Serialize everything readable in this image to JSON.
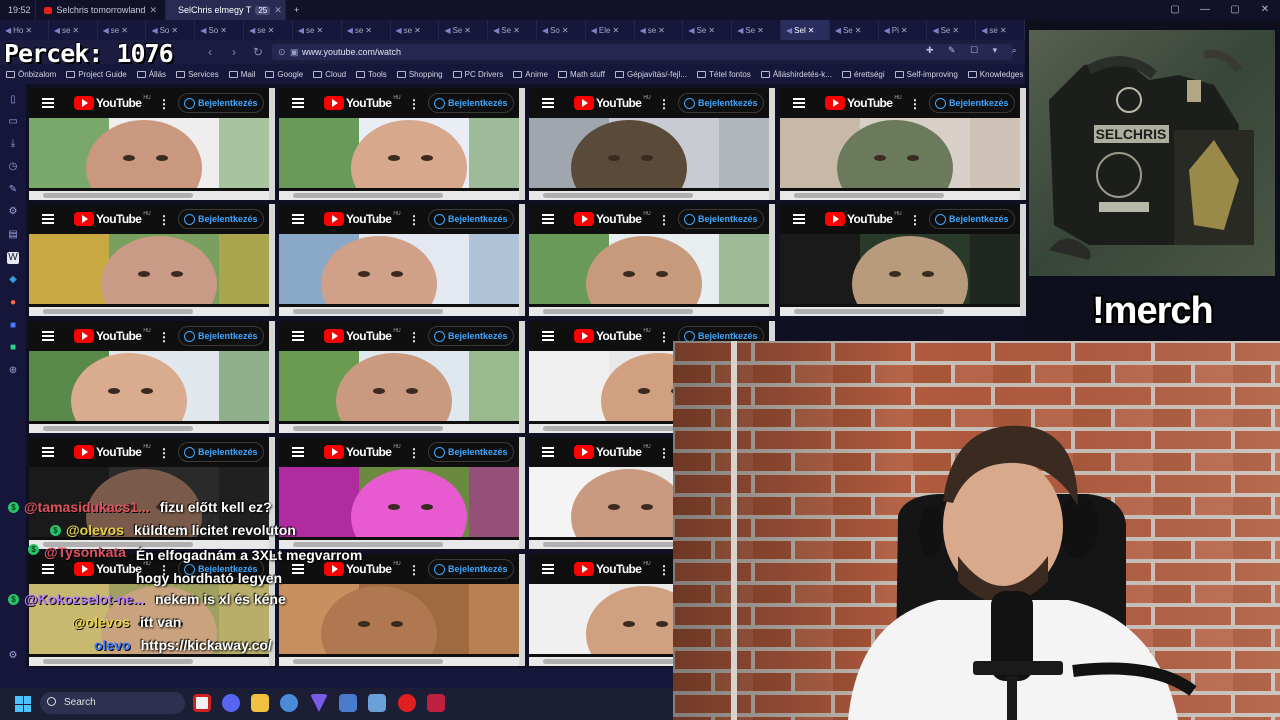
{
  "tabstrip": {
    "clock": "19:52",
    "tabs": [
      {
        "title": "Selchris tomorrowland",
        "active": false
      },
      {
        "title": "SelChris elmegy T",
        "active": true,
        "count": "25"
      }
    ],
    "new_tab": "+"
  },
  "pinned_tabs": [
    "Ho",
    "se",
    "se",
    "So",
    "So",
    "se",
    "se",
    "se",
    "se",
    "Se",
    "Se",
    "So",
    "Ele",
    "se",
    "Se",
    "Se",
    "Sel",
    "Se",
    "Pi",
    "Se",
    "se"
  ],
  "overlay": {
    "percek_label": "Percek: 1076",
    "merch_command": "!merch"
  },
  "address": {
    "url": "www.youtube.com/watch"
  },
  "bookmarks": [
    "Önbizalom",
    "Project Guide",
    "Állás",
    "Services",
    "Mail",
    "Google",
    "Cloud",
    "Tools",
    "Shopping",
    "PC Drivers",
    "Anime",
    "Math stuff",
    "Gépjavítás/-fejl...",
    "Tétel fontos",
    "Álláshirdetés-k...",
    "érettségi",
    "Self-improving",
    "Knowledges"
  ],
  "youtube": {
    "logo_text": "YouTube",
    "country": "HU",
    "signin_label": "Bejelentkezés"
  },
  "chat": [
    {
      "user": "@tamasidukacs1...",
      "message": "fizu előtt kell ez?",
      "color": "#e0525e",
      "badge": true
    },
    {
      "user": "@olevos",
      "message": "küldtem licitet revoluton",
      "color": "#e6d34a",
      "badge": true
    },
    {
      "user": "@Tysonkata",
      "message": "Én elfogadnám a 3XLt megvarrom hogy hordható legyen",
      "color": "#e0525e",
      "badge": true
    },
    {
      "user": "@Kokozselot-ne...",
      "message": "nekem is xl és kéne",
      "color": "#b37bff",
      "badge": true
    },
    {
      "user": "@olevos",
      "message": "itt van",
      "color": "#e6d34a",
      "badge": false
    },
    {
      "user": "olevo",
      "message": "https://kickaway.co/",
      "color": "#3a7bff",
      "badge": false
    }
  ],
  "taskbar": {
    "search_label": "Search"
  }
}
